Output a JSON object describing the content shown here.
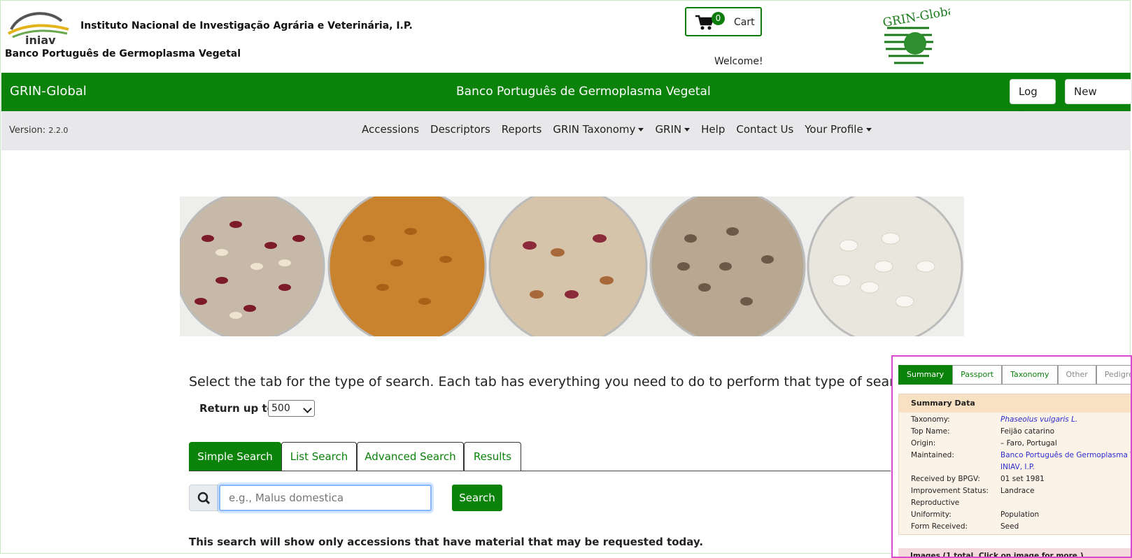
{
  "header": {
    "institute": "Instituto Nacional de Investigação Agrária e Veterinária, I.P.",
    "subtitle": "Banco Português de Germoplasma Vegetal",
    "logo_text": "iniav",
    "cart_count": "0",
    "cart_label": "Cart",
    "welcome": "Welcome!",
    "gg_logo_text": "GRIN-Global"
  },
  "greenbar": {
    "brand": "GRIN-Global",
    "title": "Banco Português de Germoplasma Vegetal",
    "login": "Log in",
    "new_user": "New User"
  },
  "nav": {
    "version_label": "Version:",
    "version_value": "2.2.0",
    "items": [
      "Accessions",
      "Descriptors",
      "Reports",
      "GRIN Taxonomy",
      "GRIN",
      "Help",
      "Contact Us",
      "Your Profile"
    ]
  },
  "search": {
    "instruction": "Select the tab for the type of search. Each tab has everything you need to do to perform that type of search.",
    "return_label": "Return up to",
    "return_value": "500",
    "tabs": [
      "Simple Search",
      "List Search",
      "Advanced Search",
      "Results"
    ],
    "placeholder": "e.g., Malus domestica",
    "button": "Search",
    "note": "This search will show only accessions that have material that may be requested today."
  },
  "preview": {
    "tabs": [
      "Summary",
      "Passport",
      "Taxonomy",
      "Other",
      "Pedigree"
    ],
    "summary_title": "Summary Data",
    "rows": [
      {
        "k": "Taxonomy:",
        "v": "Phaseolus vulgaris L."
      },
      {
        "k": "Top Name:",
        "v": "Feijão catarino"
      },
      {
        "k": "Origin:",
        "v": "– Faro, Portugal"
      },
      {
        "k": "Maintained:",
        "v": "Banco Português de Germoplasma Veg"
      },
      {
        "k": "",
        "v": "INIAV, I.P."
      },
      {
        "k": "Received by BPGV:",
        "v": "01 set 1981"
      },
      {
        "k": "Improvement Status:",
        "v": "Landrace"
      },
      {
        "k": "Reproductive",
        "v": ""
      },
      {
        "k": "Uniformity:",
        "v": "Population"
      },
      {
        "k": "Form Received:",
        "v": "Seed"
      }
    ],
    "images_title": "Images (1 total. Click on image for more.)"
  },
  "colors": {
    "brand_green": "#0b830b",
    "nav_grey": "#e8e8ea",
    "preview_border": "#d84bd0"
  }
}
